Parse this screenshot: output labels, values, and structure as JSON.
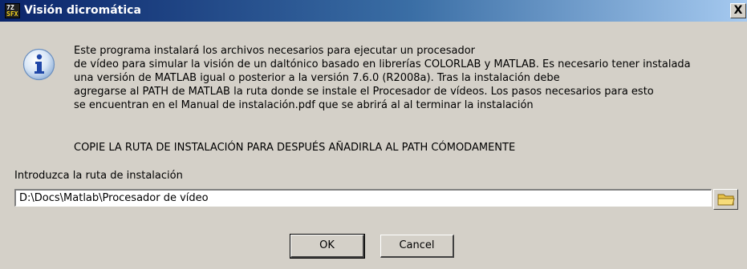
{
  "window": {
    "title": "Visión dicromática",
    "app_icon": {
      "top": "7Z",
      "bottom": "SFX"
    },
    "close_label": "X"
  },
  "message": {
    "lines": [
      "Este programa instalará los archivos necesarios para ejecutar un procesador",
      "de vídeo para simular la visión de un daltónico basado en librerías COLORLAB y MATLAB. Es necesario tener instalada",
      "una versión de MATLAB igual o posterior a la versión 7.6.0 (R2008a). Tras la instalación debe",
      "agregarse al PATH de MATLAB la ruta donde se instale el Procesador de vídeos. Los pasos necesarios para esto",
      "se encuentran en el Manual de instalación.pdf que se abrirá al al terminar la instalación"
    ],
    "notice": "COPIE LA RUTA DE INSTALACIÓN PARA DESPUÉS AÑADIRLA AL PATH CÓMODAMENTE"
  },
  "path": {
    "label": "Introduzca la ruta de instalación",
    "value": "D:\\Docs\\Matlab\\Procesador de vídeo"
  },
  "buttons": {
    "ok": "OK",
    "cancel": "Cancel"
  },
  "icons": {
    "info": "info-icon",
    "browse": "folder-icon"
  },
  "colors": {
    "title_start": "#0a246a",
    "title_end": "#a6caf0",
    "face": "#d4d0c8"
  }
}
